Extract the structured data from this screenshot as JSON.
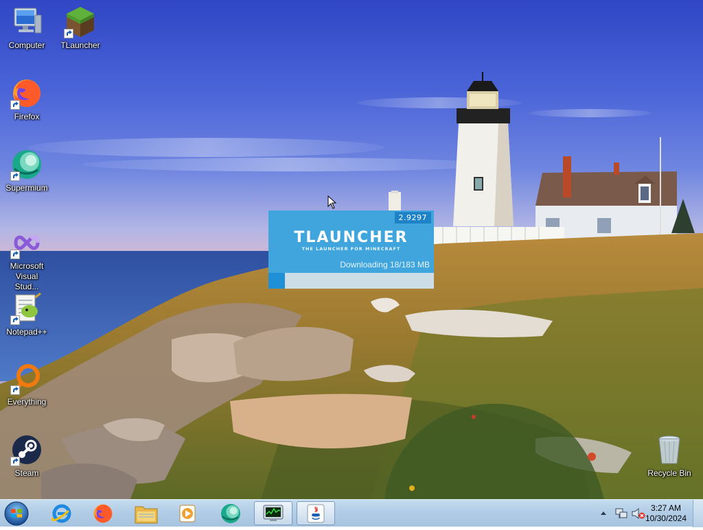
{
  "desktop": {
    "icons": [
      {
        "label": "Computer",
        "icon": "computer-icon"
      },
      {
        "label": "TLauncher",
        "icon": "tlauncher-icon"
      },
      {
        "label": "Firefox",
        "icon": "firefox-icon"
      },
      {
        "label": "Supermium",
        "icon": "supermium-icon"
      },
      {
        "label": "Microsoft Visual Stud...",
        "icon": "visual-studio-icon"
      },
      {
        "label": "Notepad++",
        "icon": "notepadpp-icon"
      },
      {
        "label": "Everything",
        "icon": "everything-icon"
      },
      {
        "label": "Steam",
        "icon": "steam-icon"
      },
      {
        "label": "Recycle Bin",
        "icon": "recycle-bin-icon"
      }
    ]
  },
  "splash": {
    "version": "2.9297",
    "title": "TLAUNCHER",
    "subtitle": "THE LAUNCHER FOR MINECRAFT",
    "status": "Downloading 18/183 MB",
    "progress": 0.1,
    "accent": "#3fa5dc"
  },
  "taskbar": {
    "pinned": [
      {
        "name": "internet-explorer-icon"
      },
      {
        "name": "firefox-icon"
      },
      {
        "name": "file-explorer-icon"
      },
      {
        "name": "media-player-icon"
      },
      {
        "name": "supermium-icon"
      },
      {
        "name": "task-manager-icon"
      },
      {
        "name": "java-icon"
      }
    ],
    "clock": {
      "time": "3:27 AM",
      "date": "10/30/2024"
    }
  }
}
